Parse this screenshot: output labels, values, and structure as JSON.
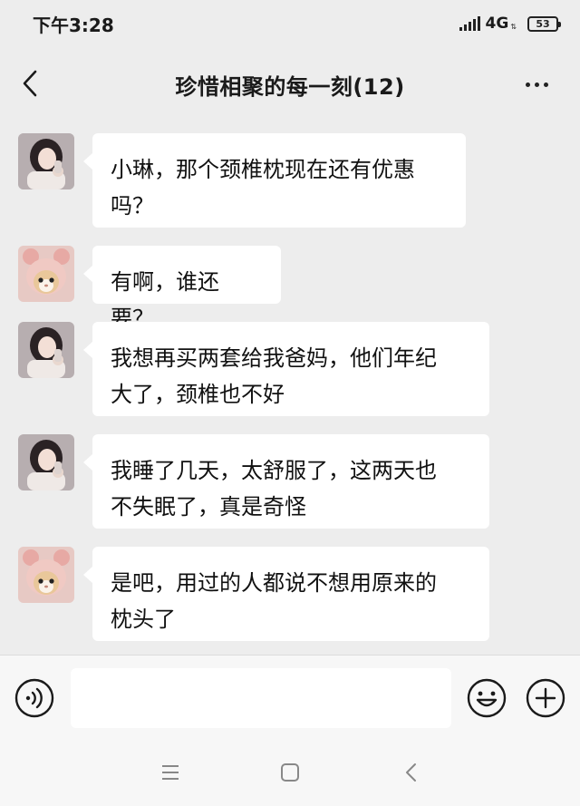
{
  "status_bar": {
    "time": "下午3:28",
    "network": "4G",
    "battery": "53"
  },
  "header": {
    "title": "珍惜相聚的每一刻(12)",
    "back_icon": "chevron-left-icon",
    "more_icon": "more-dots-icon"
  },
  "messages": [
    {
      "sender": "girl",
      "lines": [
        "小琳，那个颈椎枕现在还有优惠",
        "吗？"
      ]
    },
    {
      "sender": "cat",
      "lines": [
        "有啊，谁还要？"
      ]
    },
    {
      "sender": "girl",
      "lines": [
        "我想再买两套给我爸妈，他们年纪",
        "大了，颈椎也不好"
      ]
    },
    {
      "sender": "girl",
      "lines": [
        "我睡了几天，太舒服了，这两天也",
        "不失眠了，真是奇怪"
      ]
    },
    {
      "sender": "cat",
      "lines": [
        "是吧，用过的人都说不想用原来的",
        "枕头了"
      ]
    }
  ],
  "input_bar": {
    "voice_icon": "voice-icon",
    "emoji_icon": "emoji-icon",
    "plus_icon": "plus-icon"
  },
  "nav_bar": {
    "menu_icon": "menu-icon",
    "home_icon": "home-square-icon",
    "back_icon": "back-triangle-icon"
  },
  "colors": {
    "background": "#ededed",
    "bubble": "#ffffff",
    "text": "#111111"
  }
}
